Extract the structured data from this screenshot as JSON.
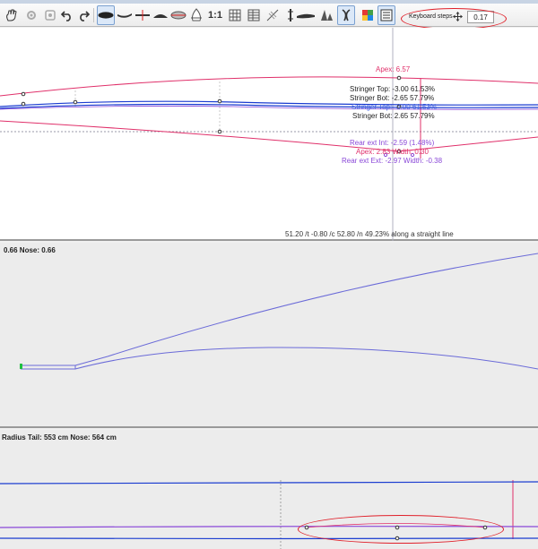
{
  "window": {
    "title": ""
  },
  "toolbar": {
    "scale_label": "1:1",
    "keyboard_steps_label": "Keyboard steps",
    "keyboard_steps_value": "0.17",
    "buttons": [
      "hand-tool",
      "settings",
      "settings-2",
      "undo",
      "redo",
      "board-top-view",
      "board-side-view",
      "rocker-cross-view",
      "slice-view",
      "combined-view",
      "deck-view",
      "scale",
      "grid",
      "table",
      "guide",
      "stringer",
      "fin",
      "fins",
      "cross-section",
      "colors",
      "properties"
    ]
  },
  "top_view": {
    "apex_label": "Apex: 6.57",
    "stringer_top_1": "Stringer Top: -3.00 61.53%",
    "stringer_bot_1": "Stringer Bot: -2.65 57.79%",
    "stringer_top_2": "Stringer Top: -3.00 61.53%",
    "stringer_bot_2": "Stringer Bot: 2.65 57.79%",
    "rear_ext_int": "Rear ext Int: -2.59 (1.48%)",
    "apex_width": "Apex: 2.83 Width: 0.30",
    "rear_ext_ext": "Rear ext Ext: -2.97 Width: -0.38",
    "status_line": "51.20 /t -0.80 /c 52.80 /n 49.23% along a straight line"
  },
  "mid_view": {
    "header": "0.66 Nose:  0.66"
  },
  "bottom_view": {
    "header": "Radius Tail: 553 cm Nose: 564 cm"
  },
  "colors": {
    "pink": "#e0306a",
    "blue": "#1a3cd0",
    "violet": "#8a48d8",
    "red_highlight": "#e0202a"
  }
}
